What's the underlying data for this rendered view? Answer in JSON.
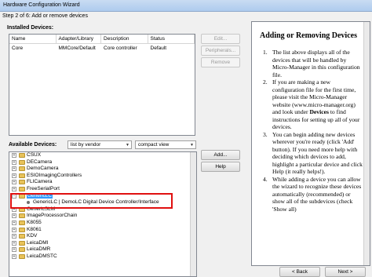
{
  "window": {
    "title": "Hardware Configuration Wizard",
    "step": "Step 2 of 6: Add or remove devices"
  },
  "installed": {
    "label": "Installed Devices:",
    "columns": [
      "Name",
      "Adapter/Library",
      "Description",
      "Status"
    ],
    "rows": [
      [
        "Core",
        "MMCore/Default",
        "Core controller",
        "Default"
      ]
    ],
    "buttons": {
      "edit": "Edit...",
      "peripherals": "Peripherals...",
      "remove": "Remove"
    }
  },
  "available": {
    "label": "Available Devices:",
    "sort_combo": "list by vendor",
    "view_combo": "compact view",
    "buttons": {
      "add": "Add...",
      "help": "Help"
    },
    "tree": [
      {
        "label": "CSUX",
        "type": "folder"
      },
      {
        "label": "DECamera",
        "type": "folder"
      },
      {
        "label": "DemoCamera",
        "type": "folder"
      },
      {
        "label": "ESIOImagingControllers",
        "type": "folder"
      },
      {
        "label": "FLICamera",
        "type": "folder"
      },
      {
        "label": "FreeSerialPort",
        "type": "folder"
      },
      {
        "label": "GenericLC",
        "type": "folder",
        "selected": true,
        "expanded": true
      },
      {
        "label": "GenericLC | DemoLC Digital Device Controller/Interface",
        "type": "child"
      },
      {
        "label": "GenericSLM",
        "type": "folder"
      },
      {
        "label": "ImageProcessorChain",
        "type": "folder"
      },
      {
        "label": "K8055",
        "type": "folder"
      },
      {
        "label": "K8061",
        "type": "folder"
      },
      {
        "label": "KDV",
        "type": "folder"
      },
      {
        "label": "LeicaDMI",
        "type": "folder"
      },
      {
        "label": "LeicaDMR",
        "type": "folder"
      },
      {
        "label": "LeicaDMSTC",
        "type": "folder"
      }
    ]
  },
  "help": {
    "title": "Adding or Removing Devices",
    "items": [
      {
        "num": "1.",
        "text": "The list above displays all of the devices that will be handled by Micro-Manager in this configuration file."
      },
      {
        "num": "2.",
        "pre": "If you are making a new configuration file for the first time, please visit the Micro-Manager website (www.micro-manager.org) and look under ",
        "bold": "Devices",
        "post": " to find instructions for setting up all of your devices."
      },
      {
        "num": "3.",
        "text": "You can begin adding new devices wherever you're ready (click 'Add' button). If you need more help with deciding which devices to add, highlight a particular device and click Help (it really helps!)."
      },
      {
        "num": "4.",
        "text": "While adding a device you can allow the wizard to recognize these devices automatically (recommended) or show all of the subdevices (check 'Show all)"
      }
    ]
  },
  "nav": {
    "back": "< Back",
    "next": "Next >"
  }
}
